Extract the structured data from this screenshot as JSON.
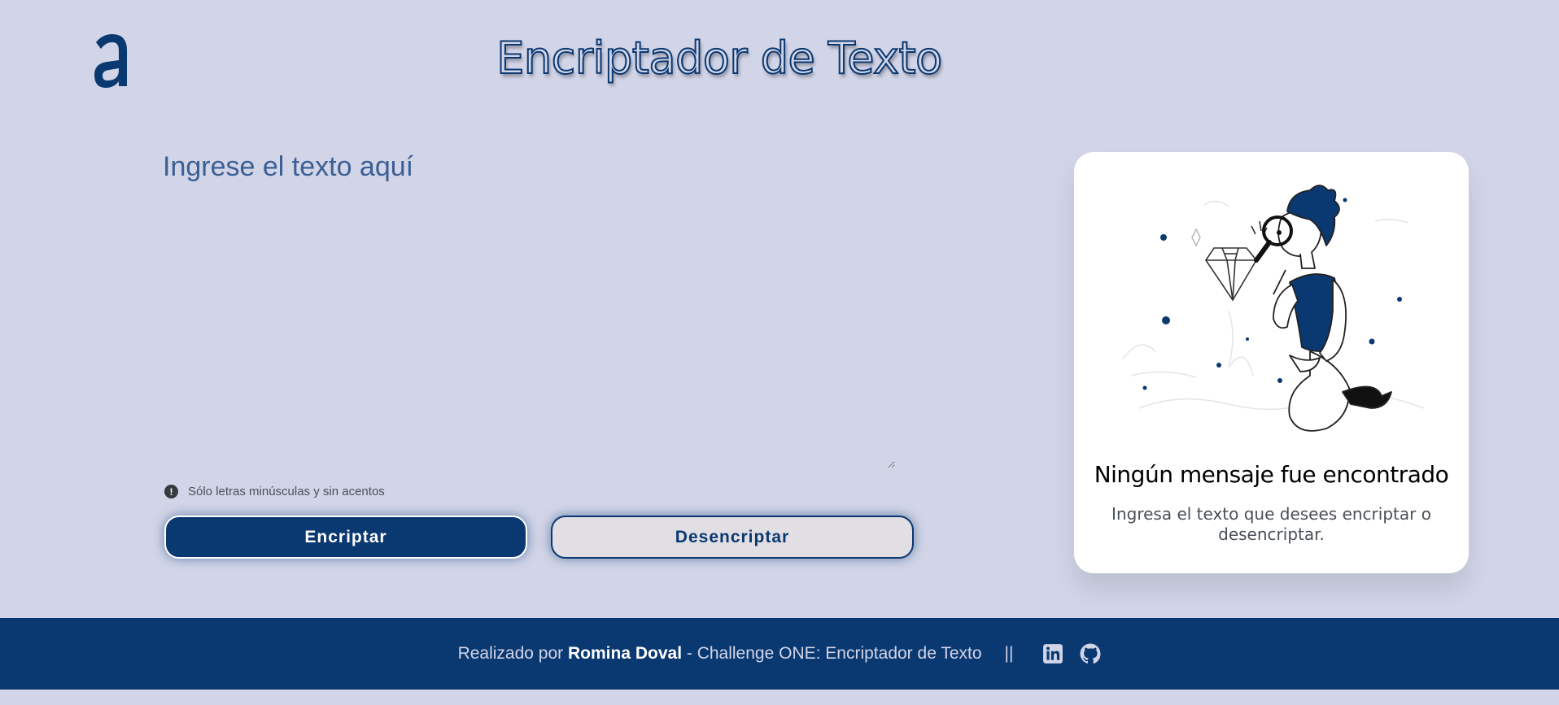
{
  "header": {
    "title": "Encriptador de Texto",
    "logo_icon": "alura-logo-icon"
  },
  "input": {
    "placeholder": "Ingrese el texto aquí",
    "value": ""
  },
  "hint": {
    "icon": "exclamation-circle-icon",
    "text": "Sólo letras minúsculas y sin acentos"
  },
  "buttons": {
    "encrypt": "Encriptar",
    "decrypt": "Desencriptar"
  },
  "result_card": {
    "illustration": "person-magnifying-glass-illustration",
    "title": "Ningún mensaje fue encontrado",
    "text": "Ingresa el texto que desees encriptar o desencriptar."
  },
  "footer": {
    "prefix": "Realizado por",
    "author": "Romina Doval",
    "suffix": "- Challenge ONE: Encriptador de Texto",
    "separator": "||",
    "icons": [
      "linkedin-icon",
      "github-icon"
    ]
  },
  "colors": {
    "background": "#d2d5e8",
    "primary": "#0a3871",
    "secondary_button": "#e2dfe4",
    "card": "#ffffff"
  }
}
